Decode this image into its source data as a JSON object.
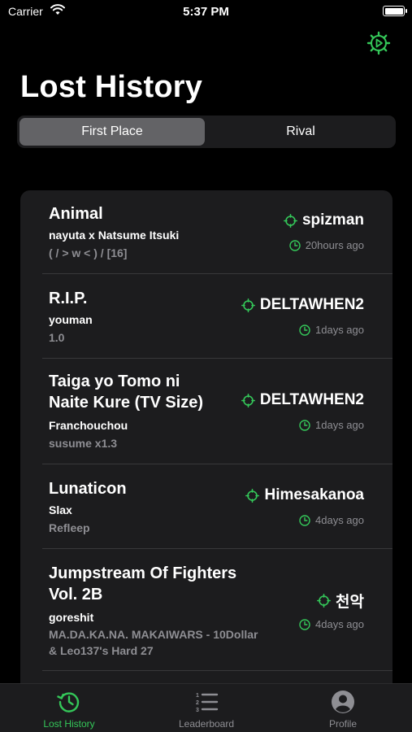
{
  "status_bar": {
    "carrier": "Carrier",
    "time": "5:37 PM"
  },
  "header": {
    "title": "Lost History"
  },
  "segmented": {
    "first_place": "First Place",
    "rival": "Rival",
    "selected": "First Place"
  },
  "rows": [
    {
      "song_lines": [
        "Animal"
      ],
      "artist": "nayuta x Natsume Itsuki",
      "diff_lines": [
        "( / > w < ) / [16]"
      ],
      "rival": "spizman",
      "ago": "20hours ago"
    },
    {
      "song_lines": [
        "R.I.P."
      ],
      "artist": "youman",
      "diff_lines": [
        "1.0"
      ],
      "rival": "DELTAWHEN2",
      "ago": "1days ago"
    },
    {
      "song_lines": [
        "Taiga yo Tomo ni",
        "Naite Kure (TV Size)"
      ],
      "artist": "Franchouchou",
      "diff_lines": [
        "susume x1.3"
      ],
      "rival": "DELTAWHEN2",
      "ago": "1days ago"
    },
    {
      "song_lines": [
        "Lunaticon"
      ],
      "artist": "Slax",
      "diff_lines": [
        "Refleep"
      ],
      "rival": "Himesakanoa",
      "ago": "4days ago"
    },
    {
      "song_lines": [
        "Jumpstream Of Fighters",
        "Vol. 2B"
      ],
      "artist": "goreshit",
      "diff_lines": [
        "MA.DA.KA.NA. MAKAIWARS - 10Dollar",
        "& Leo137's Hard 27"
      ],
      "rival": "천악",
      "ago": "4days ago"
    }
  ],
  "tabbar": {
    "tabs": [
      {
        "label": "Lost History",
        "icon": "clock-history-icon",
        "active": true
      },
      {
        "label": "Leaderboard",
        "icon": "numbered-list-icon",
        "active": false
      },
      {
        "label": "Profile",
        "icon": "person-circle-icon",
        "active": false
      }
    ]
  },
  "colors": {
    "accent": "#34c759",
    "background": "#000000",
    "card": "#1c1c1e",
    "secondary_text": "#8e8e93"
  }
}
